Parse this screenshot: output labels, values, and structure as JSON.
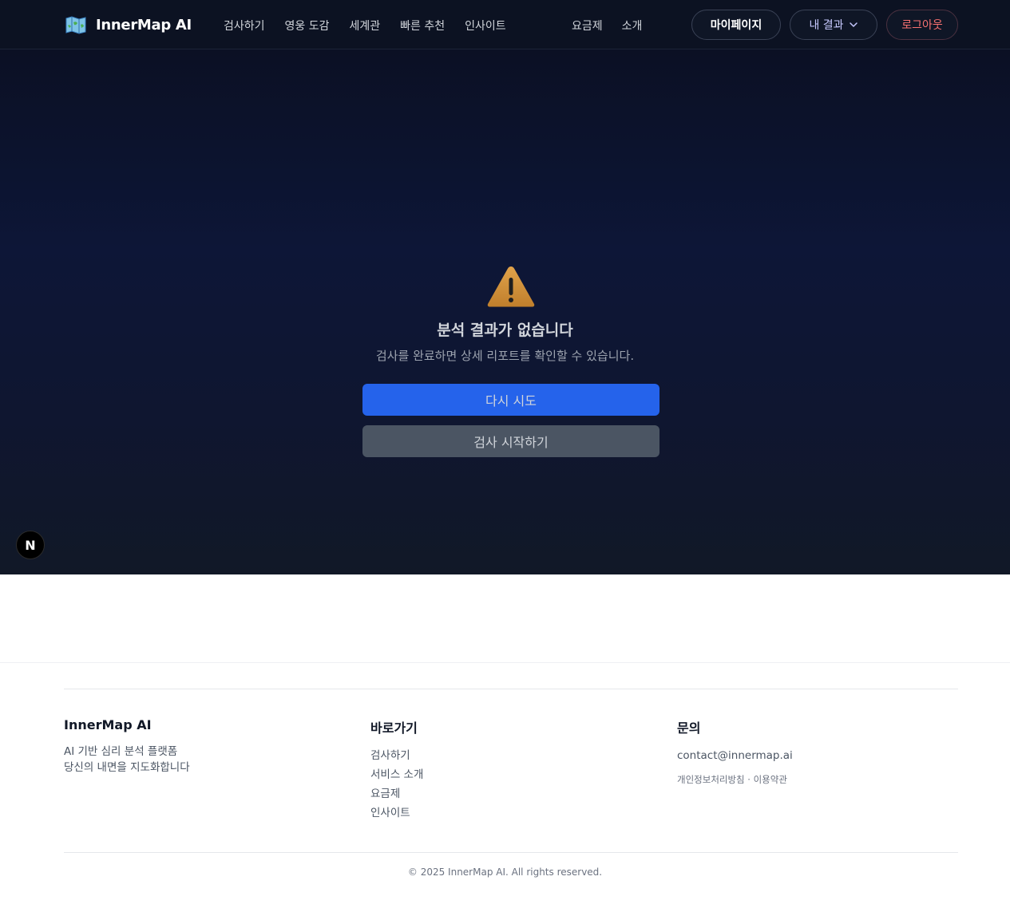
{
  "header": {
    "brand": "InnerMap AI",
    "nav_main": [
      "검사하기",
      "영웅 도감",
      "세계관",
      "빠른 추천",
      "인사이트"
    ],
    "nav_secondary": [
      "요금제",
      "소개"
    ],
    "mypage": "마이페이지",
    "my_results": "내 결과",
    "logout": "로그아웃"
  },
  "main": {
    "title": "분석 결과가 없습니다",
    "description": "검사를 완료하면 상세 리포트를 확인할 수 있습니다.",
    "retry_button": "다시 시도",
    "start_button": "검사 시작하기",
    "badge": "N"
  },
  "footer": {
    "brand": "InnerMap AI",
    "tagline1": "AI 기반 심리 분석 플랫폼",
    "tagline2": "당신의 내면을 지도화합니다",
    "shortcuts_title": "바로가기",
    "shortcuts": [
      "검사하기",
      "서비스 소개",
      "요금제",
      "인사이트"
    ],
    "contact_title": "문의",
    "email": "contact@innermap.ai",
    "policies": "개인정보처리방침 · 이용약관",
    "copyright": "© 2025 InnerMap AI. All rights reserved."
  },
  "colors": {
    "primary": "#2563eb",
    "secondary_button": "#4b5563",
    "header_bg": "#0c1222",
    "logout": "#f87171",
    "warning": "#d4933a"
  }
}
